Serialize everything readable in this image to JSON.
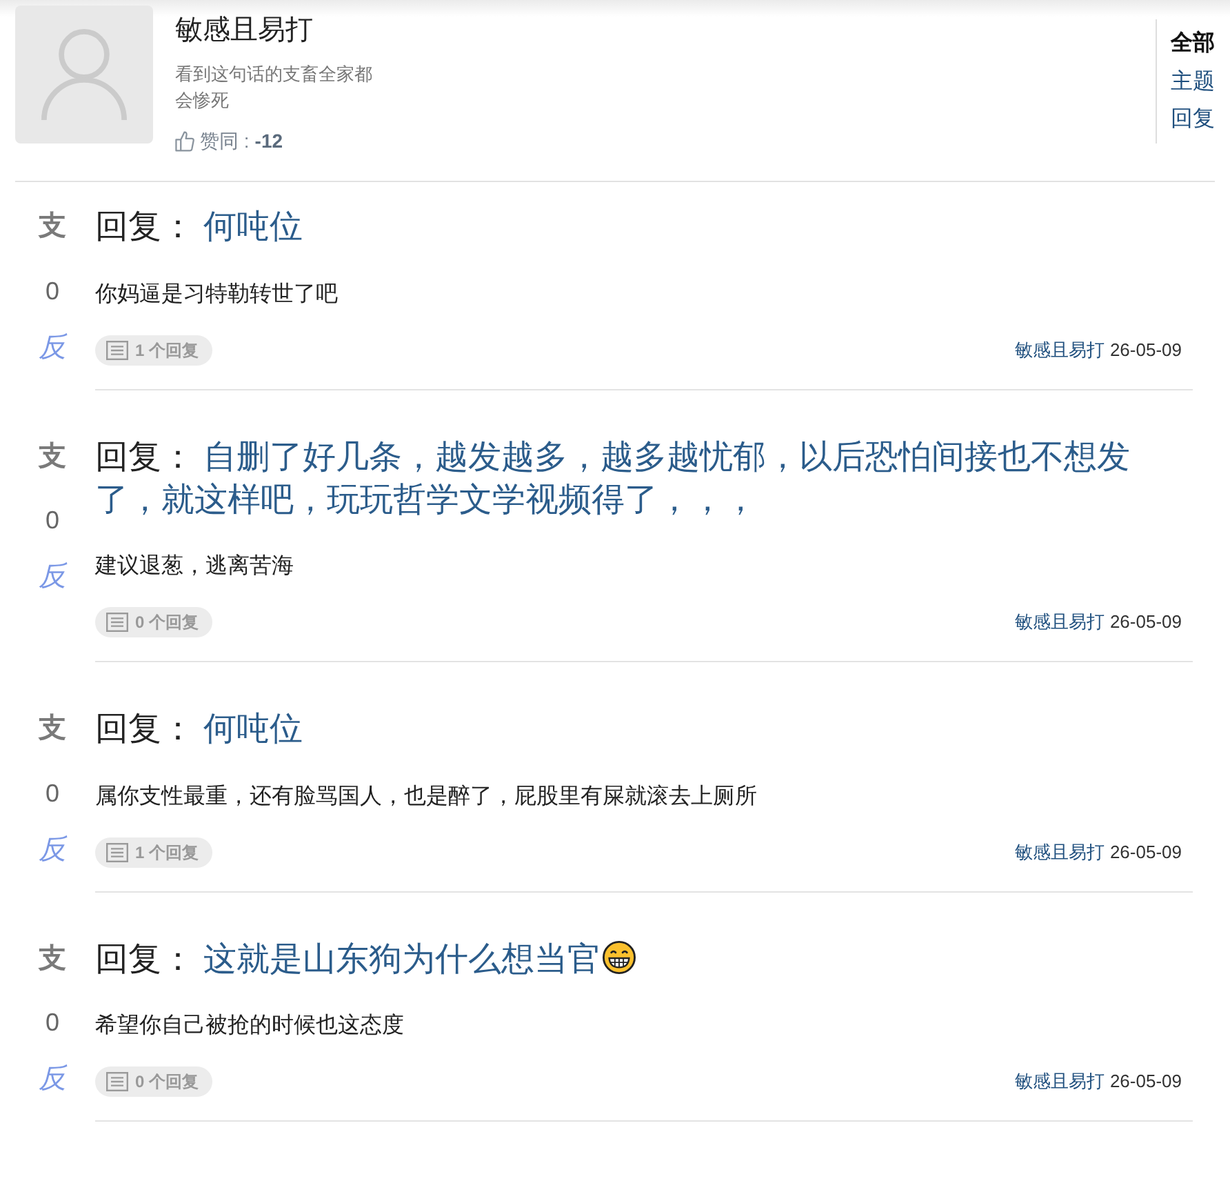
{
  "profile": {
    "name": "敏感且易打",
    "bio": "看到这句话的支畜全家都会惨死",
    "likes_label": "赞同 :",
    "likes_value": "-12"
  },
  "filter_tabs": [
    {
      "label": "全部",
      "selected": true
    },
    {
      "label": "主题",
      "selected": false
    },
    {
      "label": "回复",
      "selected": false
    }
  ],
  "posts": [
    {
      "support_label": "支",
      "votes": "0",
      "oppose_label": "反",
      "reply_prefix": "回复：",
      "title": "何吨位",
      "emoji": false,
      "body": "你妈逼是习特勒转世了吧",
      "replies": "1 个回复",
      "author": "敏感且易打",
      "date": "26-05-09"
    },
    {
      "support_label": "支",
      "votes": "0",
      "oppose_label": "反",
      "reply_prefix": "回复：",
      "title": "自删了好几条，越发越多，越多越忧郁，以后恐怕间接也不想发了，就这样吧，玩玩哲学文学视频得了，，，",
      "emoji": false,
      "body": "建议退葱，逃离苦海",
      "replies": "0 个回复",
      "author": "敏感且易打",
      "date": "26-05-09"
    },
    {
      "support_label": "支",
      "votes": "0",
      "oppose_label": "反",
      "reply_prefix": "回复：",
      "title": "何吨位",
      "emoji": false,
      "body": "属你支性最重，还有脸骂国人，也是醉了，屁股里有屎就滚去上厕所",
      "replies": "1 个回复",
      "author": "敏感且易打",
      "date": "26-05-09"
    },
    {
      "support_label": "支",
      "votes": "0",
      "oppose_label": "反",
      "reply_prefix": "回复：",
      "title": "这就是山东狗为什么想当官",
      "emoji": true,
      "body": "希望你自己被抢的时候也这态度",
      "replies": "0 个回复",
      "author": "敏感且易打",
      "date": "26-05-09"
    }
  ]
}
